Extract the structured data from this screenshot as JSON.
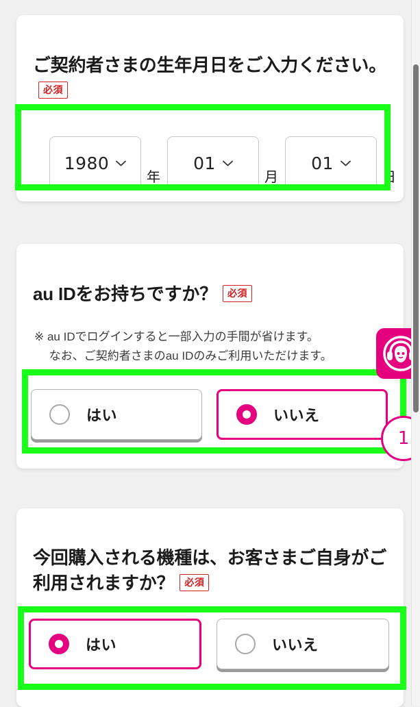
{
  "sections": [
    {
      "id": "birthdate",
      "title": "ご契約者さまの生年月日をご入力ください。",
      "required_badge": "必須",
      "date_fields": [
        {
          "value": "1980",
          "unit": "年",
          "name": "year"
        },
        {
          "value": "01",
          "unit": "月",
          "name": "month"
        },
        {
          "value": "01",
          "unit": "日",
          "name": "day"
        }
      ]
    },
    {
      "id": "auid",
      "title": "au IDをお持ちですか？",
      "required_badge": "必須",
      "note": "※ au IDでログインすると一部入力の手間が省けます。\n　 なお、ご契約者さまのau IDのみご利用いただけます。",
      "options": [
        {
          "label": "はい",
          "selected": false
        },
        {
          "label": "いいえ",
          "selected": true
        }
      ]
    },
    {
      "id": "usage",
      "title": "今回購入される機種は、お客さまご自身がご利用されますか？",
      "required_badge": "必須",
      "options": [
        {
          "label": "はい",
          "selected": true
        },
        {
          "label": "いいえ",
          "selected": false
        }
      ]
    }
  ],
  "chat_widget": {
    "icon": "operator-headset-icon",
    "badge_count": "1"
  },
  "colors": {
    "accent_magenta": "#e4007f",
    "required_red": "#d32020",
    "highlight_green": "#1aff1a",
    "page_background": "#f0f0f0",
    "card_background": "#ffffff"
  }
}
